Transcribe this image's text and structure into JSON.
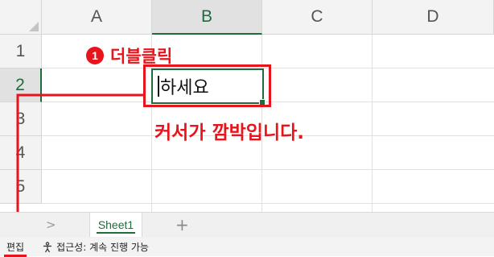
{
  "grid": {
    "columns": [
      "A",
      "B",
      "C",
      "D"
    ],
    "rows": [
      "1",
      "2",
      "3",
      "4",
      "5"
    ],
    "selected_column": "B",
    "selected_row": "2",
    "active_cell_value": "하세요"
  },
  "annotations": {
    "step_number": "1",
    "step_label": "더블클릭",
    "caption": "커서가 깜박입니다.",
    "color": "#e8141b"
  },
  "sheets": {
    "tabs": [
      {
        "label": "Sheet1",
        "active": true
      }
    ],
    "add_icon": "+",
    "nav_icon": ">"
  },
  "status": {
    "mode": "편집",
    "accessibility": "접근성: 계속 진행 가능",
    "accessibility_icon": "accessibility-icon"
  },
  "colors": {
    "accent": "#1e6b3c",
    "annotation": "#e8141b"
  }
}
